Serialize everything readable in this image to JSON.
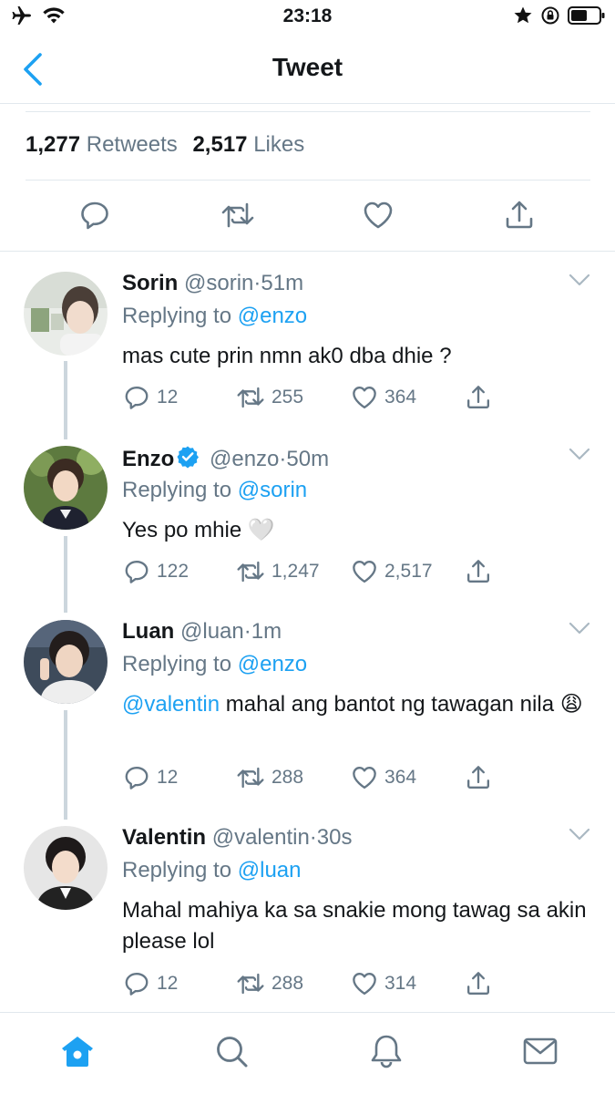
{
  "status_bar": {
    "time": "23:18",
    "left_icons": [
      "airplane-icon",
      "wifi-icon"
    ],
    "right_icons": [
      "star-icon",
      "rotation-lock-icon",
      "battery-icon"
    ]
  },
  "nav": {
    "title": "Tweet",
    "back_icon": "chevron-left-icon"
  },
  "stats": {
    "retweets_count": "1,277",
    "retweets_label": "Retweets",
    "likes_count": "2,517",
    "likes_label": "Likes"
  },
  "main_actions": [
    "reply-icon",
    "retweet-icon",
    "like-icon",
    "share-icon"
  ],
  "replies": [
    {
      "name": "Sorin",
      "verified": false,
      "handle": "@sorin",
      "sep": "·",
      "time": "51m",
      "replying_prefix": "Replying to",
      "replying_to": "@enzo",
      "text": "mas cute prin nmn ak0 dba dhie ?",
      "reply_count": "12",
      "retweet_count": "255",
      "like_count": "364"
    },
    {
      "name": "Enzo",
      "verified": true,
      "handle": "@enzo",
      "sep": "·",
      "time": "50m",
      "replying_prefix": "Replying to",
      "replying_to": "@sorin",
      "text": "Yes po mhie",
      "text_emoji": "🤍",
      "reply_count": "122",
      "retweet_count": "1,247",
      "like_count": "2,517"
    },
    {
      "name": "Luan",
      "verified": false,
      "handle": "@luan",
      "sep": "·",
      "time": "1m",
      "replying_prefix": "Replying to",
      "replying_to": "@enzo",
      "text_mention": "@valentin",
      "text": "mahal ang bantot ng tawagan nila",
      "text_emoji": "😩",
      "reply_count": "12",
      "retweet_count": "288",
      "like_count": "364"
    },
    {
      "name": "Valentin",
      "verified": false,
      "handle": "@valentin",
      "sep": "·",
      "time": "30s",
      "replying_prefix": "Replying to",
      "replying_to": "@luan",
      "text": "Mahal mahiya ka sa snakie mong tawag sa akin please lol",
      "reply_count": "12",
      "retweet_count": "288",
      "like_count": "314"
    }
  ],
  "tab_bar": [
    "home-icon",
    "search-icon",
    "notifications-icon",
    "messages-icon"
  ],
  "colors": {
    "accent": "#1da1f2",
    "muted": "#657786",
    "text": "#14171a",
    "border": "#e1e8ed",
    "thread_line": "#ccd6dd"
  }
}
